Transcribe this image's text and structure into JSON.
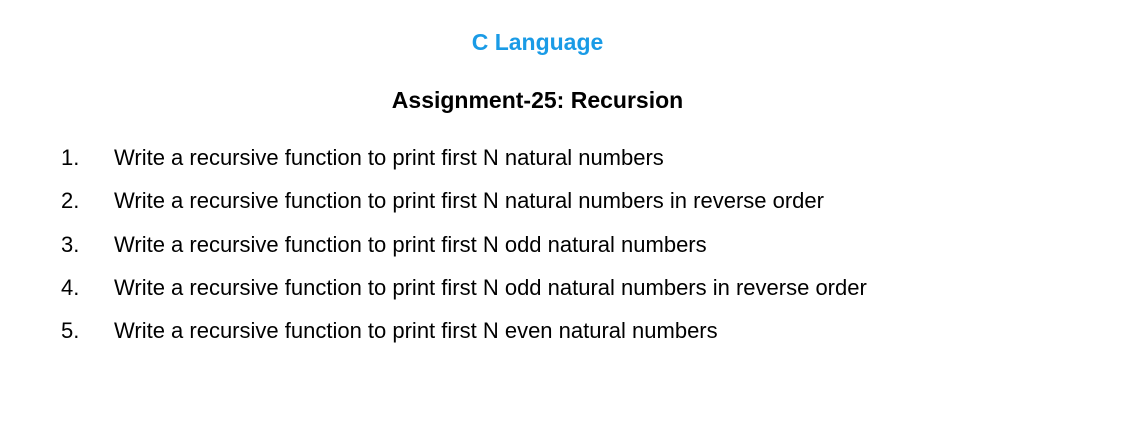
{
  "document": {
    "subject": "C Language",
    "assignment_title": "Assignment-25: Recursion",
    "colors": {
      "subject_title": "#1a9be6",
      "body_text": "#000000",
      "background": "#ffffff"
    },
    "tasks": [
      {
        "number": "1.",
        "text": "Write a recursive function to print first N natural numbers"
      },
      {
        "number": "2.",
        "text": "Write a recursive function to print first N natural numbers in reverse order"
      },
      {
        "number": "3.",
        "text": "Write a recursive function to print first N odd natural numbers"
      },
      {
        "number": "4.",
        "text": "Write a recursive function to print first N odd natural numbers in reverse order"
      },
      {
        "number": "5.",
        "text": "Write a recursive function to print first N even natural numbers"
      }
    ]
  }
}
